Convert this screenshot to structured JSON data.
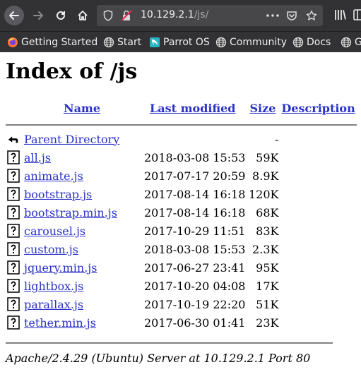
{
  "browser": {
    "url_host": "10.129.2.1",
    "url_path": "/js/",
    "bookmarks": [
      "Getting Started",
      "Start",
      "Parrot OS",
      "Community",
      "Docs",
      "G"
    ]
  },
  "page": {
    "title": "Index of /js",
    "columns": {
      "name": "Name",
      "last_modified": "Last modified",
      "size": "Size",
      "description": "Description"
    },
    "parent": {
      "name": "Parent Directory",
      "size": "-"
    },
    "files": [
      {
        "name": "all.js",
        "date": "2018-03-08 15:53",
        "size": "59K"
      },
      {
        "name": "animate.js",
        "date": "2017-07-17 20:59",
        "size": "8.9K"
      },
      {
        "name": "bootstrap.js",
        "date": "2017-08-14 16:18",
        "size": "120K"
      },
      {
        "name": "bootstrap.min.js",
        "date": "2017-08-14 16:18",
        "size": "68K"
      },
      {
        "name": "carousel.js",
        "date": "2017-10-29 11:51",
        "size": "83K"
      },
      {
        "name": "custom.js",
        "date": "2018-03-08 15:53",
        "size": "2.3K"
      },
      {
        "name": "jquery.min.js",
        "date": "2017-06-27 23:41",
        "size": "95K"
      },
      {
        "name": "lightbox.js",
        "date": "2017-10-20 04:08",
        "size": "17K"
      },
      {
        "name": "parallax.js",
        "date": "2017-10-19 22:20",
        "size": "51K"
      },
      {
        "name": "tether.min.js",
        "date": "2017-06-30 01:41",
        "size": "23K"
      }
    ],
    "footer": "Apache/2.4.29 (Ubuntu) Server at 10.129.2.1 Port 80"
  }
}
